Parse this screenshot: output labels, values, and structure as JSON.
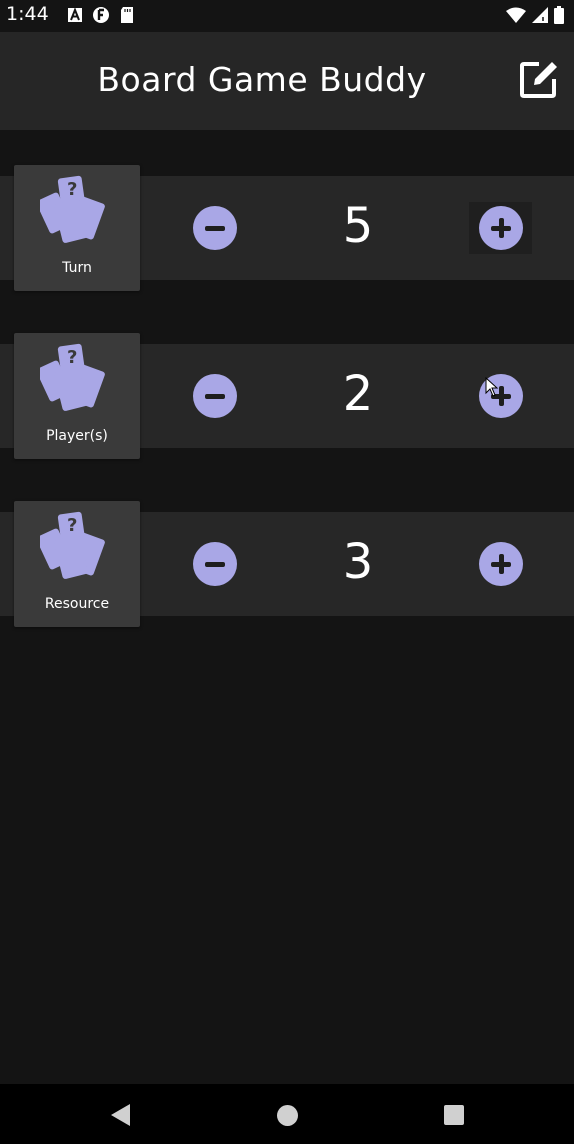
{
  "status_bar": {
    "time": "1:44"
  },
  "app_bar": {
    "title": "Board Game Buddy",
    "edit_icon": "edit-square-icon"
  },
  "counters": [
    {
      "label": "Turn",
      "value": "5",
      "icon": "cards-question-icon"
    },
    {
      "label": "Player(s)",
      "value": "2",
      "icon": "cards-question-icon"
    },
    {
      "label": "Resource",
      "value": "3",
      "icon": "cards-question-icon"
    }
  ],
  "colors": {
    "background": "#141414",
    "appbar": "#262626",
    "row": "#272727",
    "tile": "#3a3a3a",
    "accent": "#a9a7e6"
  }
}
